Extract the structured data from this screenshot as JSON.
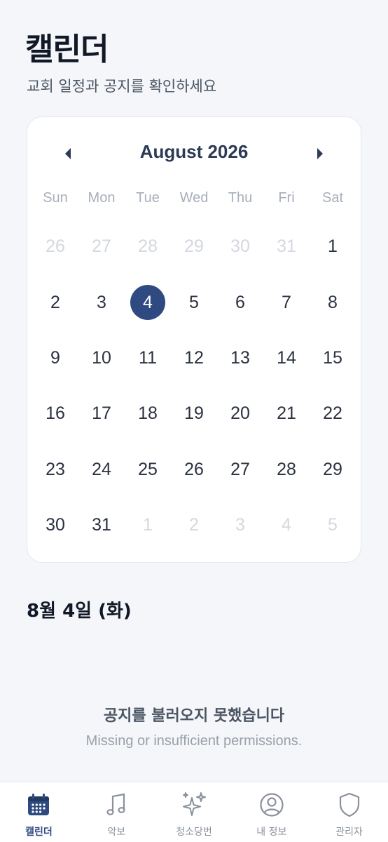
{
  "header": {
    "title": "캘린더",
    "subtitle": "교회 일정과 공지를 확인하세요"
  },
  "calendar": {
    "month_label": "August 2026",
    "weekdays": [
      "Sun",
      "Mon",
      "Tue",
      "Wed",
      "Thu",
      "Fri",
      "Sat"
    ],
    "selected_day": "4",
    "days": [
      {
        "label": "26",
        "muted": true
      },
      {
        "label": "27",
        "muted": true
      },
      {
        "label": "28",
        "muted": true
      },
      {
        "label": "29",
        "muted": true
      },
      {
        "label": "30",
        "muted": true
      },
      {
        "label": "31",
        "muted": true
      },
      {
        "label": "1",
        "muted": false
      },
      {
        "label": "2",
        "muted": false
      },
      {
        "label": "3",
        "muted": false
      },
      {
        "label": "4",
        "muted": false,
        "selected": true
      },
      {
        "label": "5",
        "muted": false
      },
      {
        "label": "6",
        "muted": false
      },
      {
        "label": "7",
        "muted": false
      },
      {
        "label": "8",
        "muted": false
      },
      {
        "label": "9",
        "muted": false
      },
      {
        "label": "10",
        "muted": false
      },
      {
        "label": "11",
        "muted": false
      },
      {
        "label": "12",
        "muted": false
      },
      {
        "label": "13",
        "muted": false
      },
      {
        "label": "14",
        "muted": false
      },
      {
        "label": "15",
        "muted": false
      },
      {
        "label": "16",
        "muted": false
      },
      {
        "label": "17",
        "muted": false
      },
      {
        "label": "18",
        "muted": false
      },
      {
        "label": "19",
        "muted": false
      },
      {
        "label": "20",
        "muted": false
      },
      {
        "label": "21",
        "muted": false
      },
      {
        "label": "22",
        "muted": false
      },
      {
        "label": "23",
        "muted": false
      },
      {
        "label": "24",
        "muted": false
      },
      {
        "label": "25",
        "muted": false
      },
      {
        "label": "26",
        "muted": false
      },
      {
        "label": "27",
        "muted": false
      },
      {
        "label": "28",
        "muted": false
      },
      {
        "label": "29",
        "muted": false
      },
      {
        "label": "30",
        "muted": false
      },
      {
        "label": "31",
        "muted": false
      },
      {
        "label": "1",
        "muted": true
      },
      {
        "label": "2",
        "muted": true
      },
      {
        "label": "3",
        "muted": true
      },
      {
        "label": "4",
        "muted": true
      },
      {
        "label": "5",
        "muted": true
      }
    ]
  },
  "selected_date_label": "8월 4일 (화)",
  "notice": {
    "title": "공지를 불러오지 못했습니다",
    "detail": "Missing or insufficient permissions."
  },
  "bottom_nav": {
    "items": [
      {
        "label": "캘린더",
        "icon": "calendar-icon",
        "active": true
      },
      {
        "label": "악보",
        "icon": "music-note-icon",
        "active": false
      },
      {
        "label": "청소당번",
        "icon": "sparkles-icon",
        "active": false
      },
      {
        "label": "내 정보",
        "icon": "user-circle-icon",
        "active": false
      },
      {
        "label": "관리자",
        "icon": "shield-icon",
        "active": false
      }
    ]
  },
  "colors": {
    "accent": "#2f4a80",
    "background": "#f4f6f9",
    "muted_day": "#d4d8df"
  }
}
